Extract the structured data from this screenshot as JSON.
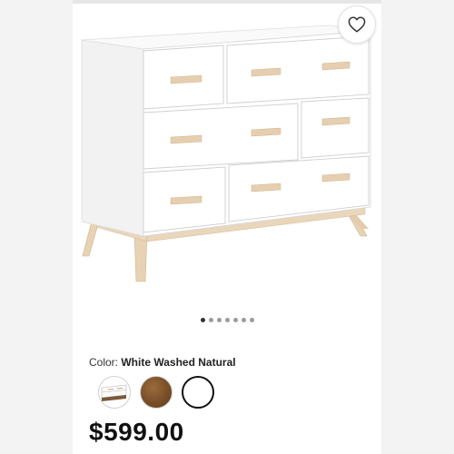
{
  "product": {
    "color_label": "Color:",
    "color_value": "White Washed Natural",
    "price": "$599.00"
  },
  "gallery": {
    "image_alt": "White dresser with natural wood legs and handles",
    "dot_count": 7,
    "active_index": 0
  },
  "swatches": [
    {
      "name": "dresser-thumbnail",
      "color": "#ffffff"
    },
    {
      "name": "walnut",
      "color": "#7a4e27"
    },
    {
      "name": "white",
      "color": "#ffffff",
      "selected": true
    }
  ],
  "colors": {
    "favorite_icon": "#333333",
    "wood": "#e6cfb1",
    "dresser_white": "#ffffff"
  }
}
